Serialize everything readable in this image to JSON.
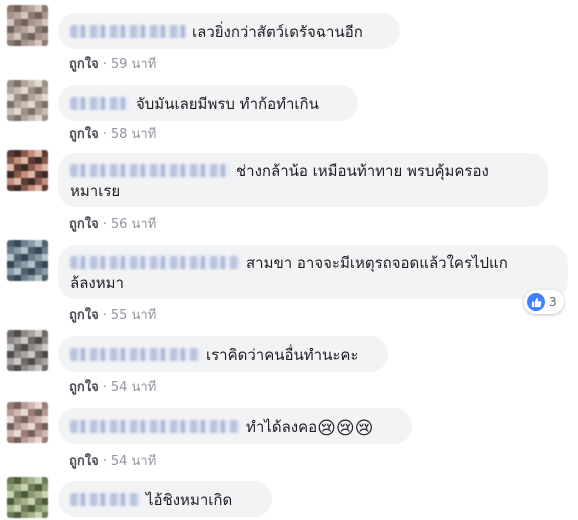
{
  "comments": [
    {
      "text": "เลวยิ่งกว่าสัตว์เดรัจฉานอีก",
      "like_label": "ถูกใจ",
      "time": "59 นาที",
      "avatar_colors": [
        "#8a7a72",
        "#b9a49a",
        "#6f625c",
        "#d3c6c0",
        "#a7958c"
      ]
    },
    {
      "text": "จับมันเลยมีพรบ  ทำก้อทำเกิน",
      "like_label": "ถูกใจ",
      "time": "58 นาที",
      "avatar_colors": [
        "#9b8f86",
        "#c7bdb5",
        "#7b7068",
        "#e2d9d1",
        "#b0a399"
      ]
    },
    {
      "text": "ช่างกล้าน้อ เหมือนท้าทาย พรบคุ้มครอง",
      "text_line2": "หมาเรย",
      "like_label": "ถูกใจ",
      "time": "56 นาที",
      "avatar_colors": [
        "#5b3b36",
        "#c28d7b",
        "#3d2a26",
        "#e0b9a6",
        "#8a5a4d"
      ]
    },
    {
      "text": "สามขา อาจจะมีเหตุรถจอดแล้วใครไปแก",
      "text_line2": "ล้ลงหมา",
      "like_label": "ถูกใจ",
      "time": "55 นาที",
      "reaction_count": "3",
      "avatar_colors": [
        "#4d6270",
        "#8a9aa6",
        "#364854",
        "#b7c1c8",
        "#6d7f8b"
      ]
    },
    {
      "text": "เราคิดว่าคนอื่นทำนะคะ",
      "like_label": "ถูกใจ",
      "time": "54 นาที",
      "avatar_colors": [
        "#6e6a68",
        "#a8a3a0",
        "#4f4b49",
        "#cbc7c4",
        "#8e8986"
      ]
    },
    {
      "text": "ทำได้ลงคอ",
      "emojis": "😢😢😢",
      "like_label": "ถูกใจ",
      "time": "54 นาที",
      "avatar_colors": [
        "#9a7d76",
        "#d0b8b1",
        "#73605b",
        "#e9d9d4",
        "#b59a92"
      ]
    },
    {
      "text": "ไอ้ชิงหมาเกิด",
      "avatar_colors": [
        "#6e7b5a",
        "#a6b38c",
        "#4e5a3d",
        "#c9d4b1",
        "#8c9a72"
      ]
    }
  ],
  "icons": {
    "reaction": "like-thumb-icon"
  },
  "colors": {
    "bubble": "#f2f3f5",
    "like": "#4b4f56",
    "meta": "#90949c",
    "reaction_blue": "#4080ff"
  }
}
